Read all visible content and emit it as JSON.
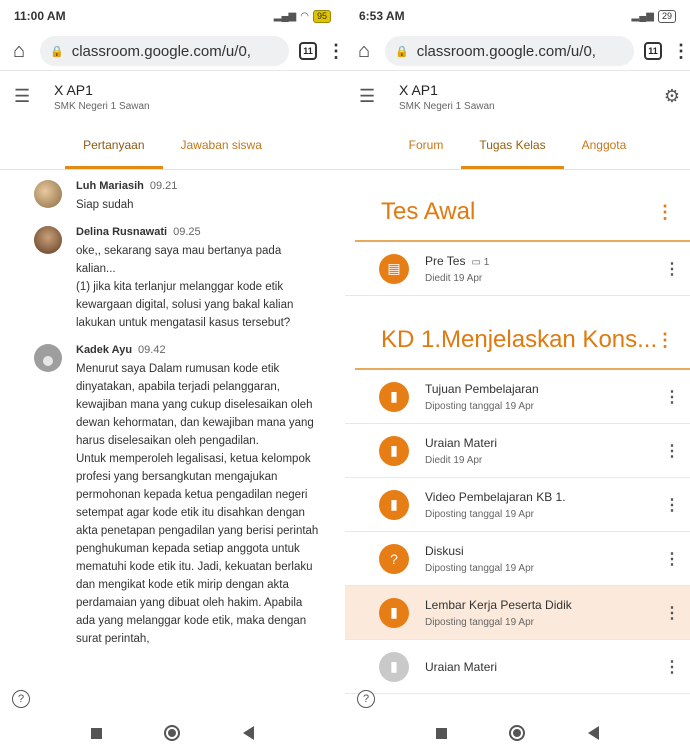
{
  "left": {
    "status": {
      "time": "11:00 AM",
      "battery": "95"
    },
    "url": "classroom.google.com/u/0,",
    "tab_count": "11",
    "class_title": "X AP1",
    "class_subtitle": "SMK Negeri 1 Sawan",
    "tabs": [
      {
        "label": "Pertanyaan"
      },
      {
        "label": "Jawaban siswa"
      }
    ],
    "comments": [
      {
        "name": "Luh Mariasih",
        "time": "09.21",
        "text": "Siap sudah"
      },
      {
        "name": "Delina Rusnawati",
        "time": "09.25",
        "text": "oke,, sekarang saya mau bertanya pada kalian...\n(1) jika kita terlanjur melanggar kode etik kewargaan digital, solusi yang bakal kalian lakukan untuk mengatasil kasus tersebut?"
      },
      {
        "name": "Kadek Ayu",
        "time": "09.42",
        "text": "Menurut saya Dalam rumusan kode etik dinyatakan, apabila terjadi pelanggaran, kewajiban mana yang cukup diselesaikan oleh dewan kehormatan, dan kewajiban mana yang harus diselesaikan oleh pengadilan.\nUntuk memperoleh legalisasi, ketua kelompok profesi yang bersangkutan mengajukan permohonan kepada ketua pengadilan negeri setempat agar kode etik itu disahkan dengan akta penetapan pengadilan yang berisi perintah penghukuman kepada setiap anggota untuk mematuhi kode etik itu. Jadi, kekuatan berlaku dan mengikat kode etik mirip dengan akta perdamaian yang dibuat oleh hakim. Apabila ada yang melanggar kode etik, maka dengan surat perintah,"
      }
    ]
  },
  "right": {
    "status": {
      "time": "6:53 AM",
      "battery": "29"
    },
    "url": "classroom.google.com/u/0,",
    "tab_count": "11",
    "class_title": "X AP1",
    "class_subtitle": "SMK Negeri 1 Sawan",
    "tabs": [
      {
        "label": "Forum"
      },
      {
        "label": "Tugas Kelas"
      },
      {
        "label": "Anggota"
      }
    ],
    "topics": [
      {
        "title": "Tes Awal",
        "items": [
          {
            "title": "Pre Tes",
            "comments": "1",
            "sub": "Diedit 19 Apr",
            "icon": "assignment-icon"
          }
        ]
      },
      {
        "title": "KD 1.Menjelaskan Kons...",
        "items": [
          {
            "title": "Tujuan Pembelajaran",
            "sub": "Diposting tanggal 19 Apr",
            "icon": "material-icon"
          },
          {
            "title": "Uraian Materi",
            "sub": "Diedit 19 Apr",
            "icon": "material-icon"
          },
          {
            "title": "Video Pembelajaran KB 1.",
            "sub": "Diposting tanggal 19 Apr",
            "icon": "material-icon"
          },
          {
            "title": "Diskusi",
            "sub": "Diposting tanggal 19 Apr",
            "icon": "question-icon"
          },
          {
            "title": "Lembar Kerja Peserta Didik",
            "sub": "Diposting tanggal 19 Apr",
            "icon": "material-icon"
          },
          {
            "title": "Uraian Materi",
            "sub": "",
            "icon": "material-icon"
          }
        ]
      }
    ]
  },
  "colors": {
    "accent": "#e07a10",
    "highlight": "#fbeadb"
  }
}
